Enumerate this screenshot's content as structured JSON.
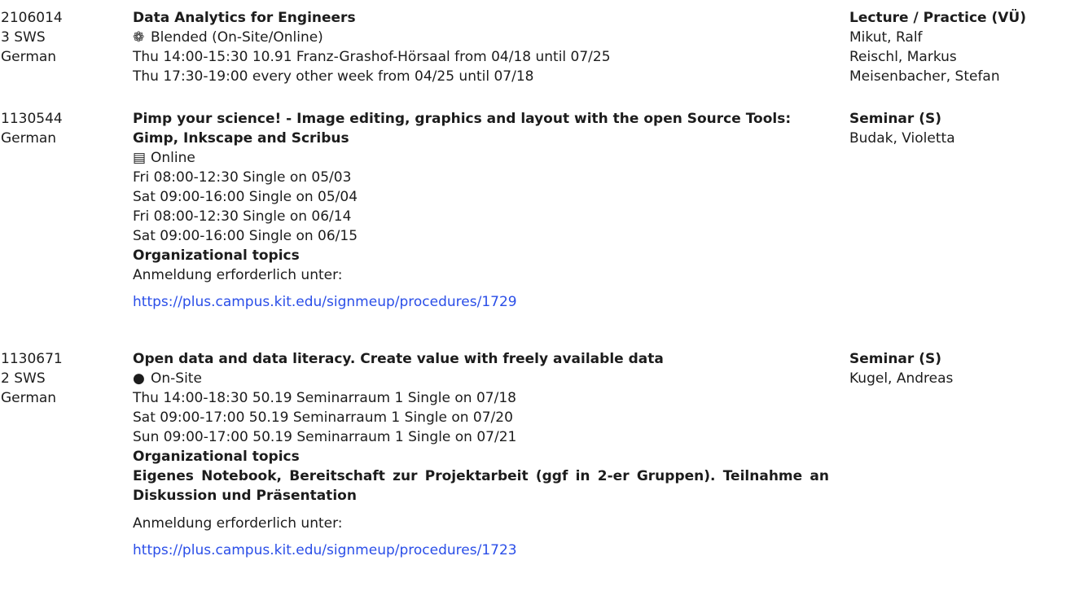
{
  "courses": [
    {
      "meta": [
        "2106014",
        "3 SWS",
        "German"
      ],
      "title": "Data Analytics for Engineers",
      "mode_icon": "❁",
      "mode": "Blended (On-Site/Online)",
      "schedule": [
        "Thu 14:00-15:30 10.91 Franz-Grashof-Hörsaal from 04/18 until 07/25",
        "Thu 17:30-19:00 every other week from 04/25 until 07/18"
      ],
      "type": "Lecture / Practice (VÜ)",
      "lecturers": [
        "Mikut, Ralf",
        "Reischl, Markus",
        "Meisenbacher, Stefan"
      ]
    },
    {
      "meta": [
        "1130544",
        "German"
      ],
      "title": "Pimp your science! - Image editing, graphics and layout with the open Source Tools: Gimp, Inkscape and Scribus",
      "mode_icon": "▤",
      "mode": "Online",
      "schedule": [
        "Fri 08:00-12:30 Single on 05/03",
        "Sat 09:00-16:00 Single on 05/04",
        "Fri 08:00-12:30 Single on 06/14",
        "Sat 09:00-16:00 Single on 06/15"
      ],
      "org_heading": "Organizational topics",
      "org_text": "Anmeldung erforderlich unter:",
      "link": "https://plus.campus.kit.edu/signmeup/procedures/1729",
      "type": "Seminar (S)",
      "lecturers": [
        "Budak, Violetta"
      ]
    },
    {
      "meta": [
        "1130671",
        "2 SWS",
        "German"
      ],
      "title": "Open data and data literacy. Create value with freely available data",
      "mode_icon": "●",
      "mode": "On-Site",
      "schedule": [
        "Thu 14:00-18:30 50.19 Seminarraum 1 Single on 07/18",
        "Sat 09:00-17:00 50.19 Seminarraum 1 Single on 07/20",
        "Sun 09:00-17:00 50.19 Seminarraum 1 Single on 07/21"
      ],
      "org_heading": "Organizational topics",
      "org_bold": "Eigenes Notebook, Bereitschaft zur Projektarbeit (ggf in 2-er Gruppen). Teilnahme an Diskussion und Präsentation",
      "org_text": "Anmeldung erforderlich unter:",
      "link": "https://plus.campus.kit.edu/signmeup/procedures/1723",
      "type": "Seminar (S)",
      "lecturers": [
        "Kugel, Andreas"
      ]
    }
  ]
}
